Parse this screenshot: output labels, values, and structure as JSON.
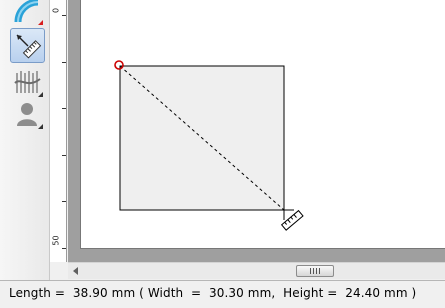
{
  "toolbar": {
    "tools": [
      {
        "name": "curve-tool",
        "icon": "curve-icon",
        "active": false
      },
      {
        "name": "measure-tool",
        "icon": "ruler-icon",
        "active": true
      },
      {
        "name": "fill-pattern-tool",
        "icon": "pattern-icon",
        "active": false
      },
      {
        "name": "stamp-tool",
        "icon": "stamp-icon",
        "active": false
      }
    ]
  },
  "ruler": {
    "labels": [
      "0",
      "50"
    ]
  },
  "canvas": {
    "shape_fill": "#efefef",
    "shape_stroke": "#000000",
    "start_marker_color": "#cc0000"
  },
  "status": {
    "text": "Length =  38.90 mm ( Width  =  30.30 mm,  Height =  24.40 mm )"
  }
}
